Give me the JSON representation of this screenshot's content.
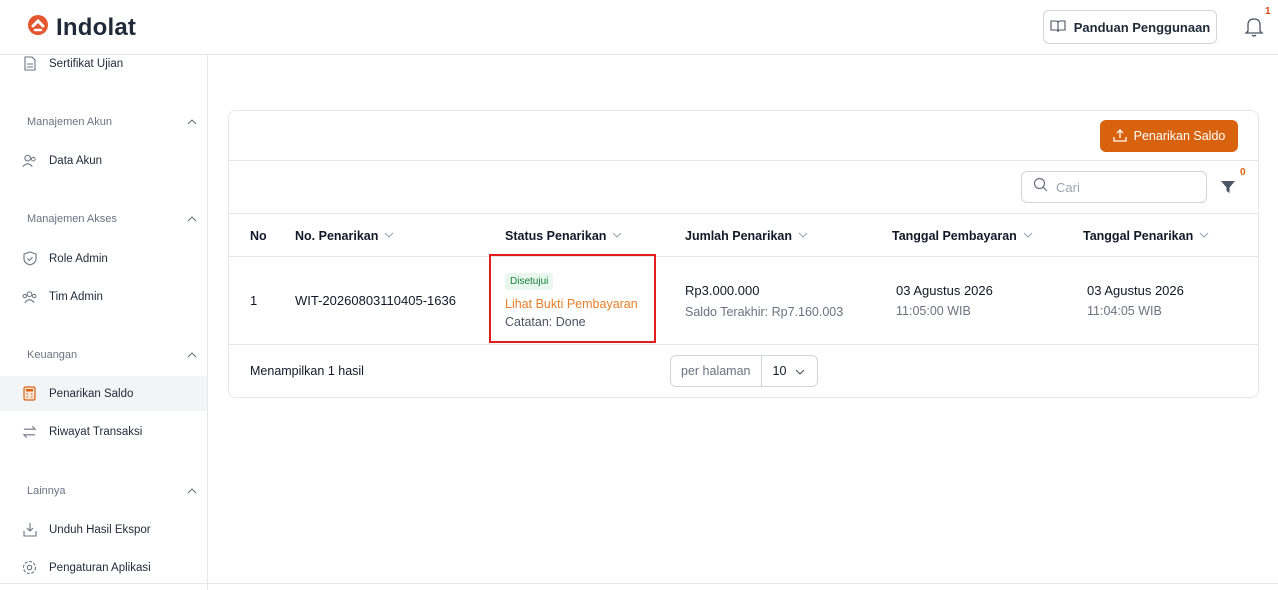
{
  "app": {
    "name": "Indolat"
  },
  "header": {
    "guide_label": "Panduan Penggunaan",
    "notif_count": "1"
  },
  "sidebar": {
    "items": [
      {
        "label": "Sertifikat Ujian"
      },
      {
        "label": "Data Akun"
      },
      {
        "label": "Role Admin"
      },
      {
        "label": "Tim Admin"
      },
      {
        "label": "Penarikan Saldo"
      },
      {
        "label": "Riwayat Transaksi"
      },
      {
        "label": "Unduh Hasil Ekspor"
      },
      {
        "label": "Pengaturan Aplikasi"
      }
    ],
    "sections": [
      {
        "label": "Manajemen Akun"
      },
      {
        "label": "Manajemen Akses"
      },
      {
        "label": "Keuangan"
      },
      {
        "label": "Lainnya"
      }
    ],
    "active_item": "Penarikan Saldo"
  },
  "main": {
    "primary_button": "Penarikan Saldo",
    "search_placeholder": "Cari",
    "filter_count": "0",
    "columns": [
      "No",
      "No. Penarikan",
      "Status Penarikan",
      "Jumlah Penarikan",
      "Tanggal Pembayaran",
      "Tanggal Penarikan"
    ],
    "rows": [
      {
        "no": "1",
        "number": "WIT-20260803110405-1636",
        "status_badge": "Disetujui",
        "proof_link": "Lihat Bukti Pembayaran",
        "note": "Catatan: Done",
        "amount": "Rp3.000.000",
        "balance": "Saldo Terakhir: Rp7.160.003",
        "pay_date": "03 Agustus 2026",
        "pay_time": "11:05:00 WIB",
        "withdraw_date": "03 Agustus 2026",
        "withdraw_time": "11:04:05 WIB"
      }
    ],
    "footer_text": "Menampilkan 1 hasil",
    "per_page_label": "per halaman",
    "per_page_value": "10"
  },
  "colors": {
    "accent": "#d9620f",
    "highlight": "#e11d1d",
    "success": "#16803c"
  }
}
